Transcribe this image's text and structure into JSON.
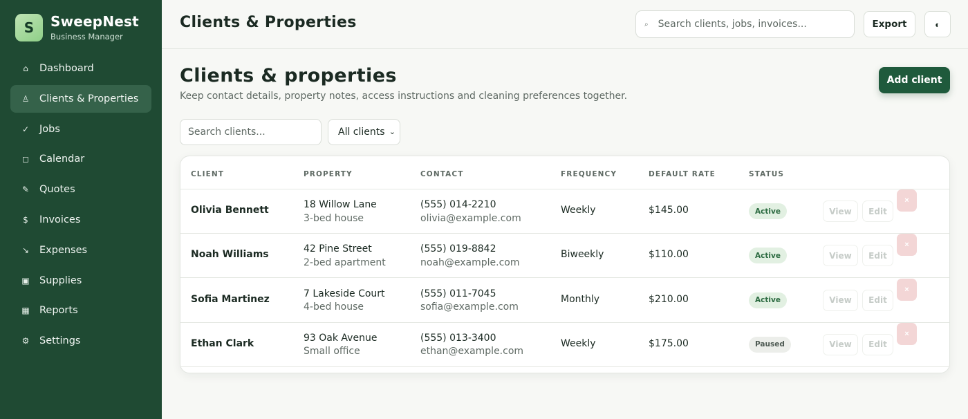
{
  "brand": {
    "logo_letter": "S",
    "name": "SweepNest",
    "subtitle": "Business Manager"
  },
  "sidebar": {
    "items": [
      {
        "label": "Dashboard",
        "icon": "⌂",
        "icon_name": "home-icon",
        "active": false
      },
      {
        "label": "Clients & Properties",
        "icon": "♙",
        "icon_name": "person-icon",
        "active": true
      },
      {
        "label": "Jobs",
        "icon": "✓",
        "icon_name": "check-icon",
        "active": false
      },
      {
        "label": "Calendar",
        "icon": "◻",
        "icon_name": "calendar-icon",
        "active": false
      },
      {
        "label": "Quotes",
        "icon": "✎",
        "icon_name": "pencil-icon",
        "active": false
      },
      {
        "label": "Invoices",
        "icon": "$",
        "icon_name": "dollar-icon",
        "active": false
      },
      {
        "label": "Expenses",
        "icon": "↘",
        "icon_name": "trend-down-icon",
        "active": false
      },
      {
        "label": "Supplies",
        "icon": "▣",
        "icon_name": "box-icon",
        "active": false
      },
      {
        "label": "Reports",
        "icon": "▦",
        "icon_name": "chart-icon",
        "active": false
      },
      {
        "label": "Settings",
        "icon": "⚙",
        "icon_name": "gear-icon",
        "active": false
      }
    ]
  },
  "topbar": {
    "title": "Clients & Properties",
    "search_placeholder": "Search clients, jobs, invoices...",
    "search_icon": "⌕",
    "export_label": "Export",
    "theme_icon": "◐"
  },
  "main": {
    "title": "Clients & properties",
    "subtitle": "Keep contact details, property notes, access instructions and cleaning preferences together.",
    "add_label": "Add client",
    "filter_placeholder": "Search clients...",
    "filter_selected": "All clients"
  },
  "table": {
    "headers": [
      "CLIENT",
      "PROPERTY",
      "CONTACT",
      "FREQUENCY",
      "DEFAULT RATE",
      "STATUS"
    ],
    "rows": [
      {
        "client": "Olivia Bennett",
        "address": "18 Willow Lane",
        "property_type": "3-bed house",
        "phone": "(555) 014-2210",
        "email": "olivia@example.com",
        "frequency": "Weekly",
        "rate": "$145.00",
        "status": "Active",
        "status_kind": "active",
        "view": "View",
        "edit": "Edit",
        "delete": "×"
      },
      {
        "client": "Noah Williams",
        "address": "42 Pine Street",
        "property_type": "2-bed apartment",
        "phone": "(555) 019-8842",
        "email": "noah@example.com",
        "frequency": "Biweekly",
        "rate": "$110.00",
        "status": "Active",
        "status_kind": "active",
        "view": "View",
        "edit": "Edit",
        "delete": "×"
      },
      {
        "client": "Sofia Martinez",
        "address": "7 Lakeside Court",
        "property_type": "4-bed house",
        "phone": "(555) 011-7045",
        "email": "sofia@example.com",
        "frequency": "Monthly",
        "rate": "$210.00",
        "status": "Active",
        "status_kind": "active",
        "view": "View",
        "edit": "Edit",
        "delete": "×"
      },
      {
        "client": "Ethan Clark",
        "address": "93 Oak Avenue",
        "property_type": "Small office",
        "phone": "(555) 013-3400",
        "email": "ethan@example.com",
        "frequency": "Weekly",
        "rate": "$175.00",
        "status": "Paused",
        "status_kind": "paused",
        "view": "View",
        "edit": "Edit",
        "delete": "×"
      }
    ]
  },
  "colors": {
    "sidebar": "#1f4a33",
    "accent": "#1f5a3c",
    "active_badge": "#e2f0e2",
    "paused_badge": "#eceeea",
    "delete": "#f3d6d6"
  }
}
